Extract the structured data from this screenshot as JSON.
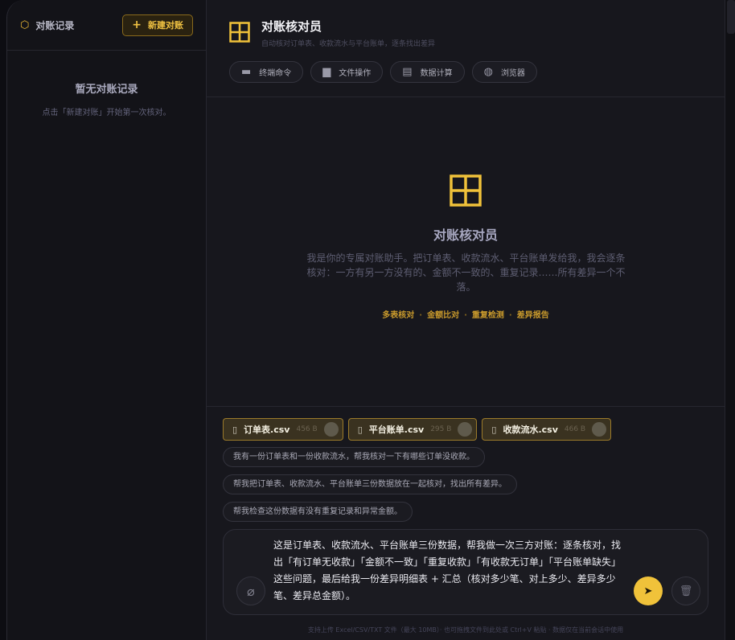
{
  "sidebar": {
    "title": "对账记录",
    "new_button": "新建对账",
    "empty_title": "暂无对账记录",
    "empty_desc": "点击「新建对账」开始第一次核对。"
  },
  "header": {
    "name": "对账核对员",
    "subtitle": "自动核对订单表、收款流水与平台账单，逐条找出差异",
    "tools": [
      {
        "icon": "terminal-icon",
        "label": "终端命令"
      },
      {
        "icon": "folder-icon",
        "label": "文件操作"
      },
      {
        "icon": "spreadsheet-icon",
        "label": "数据计算"
      },
      {
        "icon": "globe-icon",
        "label": "浏览器"
      }
    ]
  },
  "welcome": {
    "title": "对账核对员",
    "desc": "我是你的专属对账助手。把订单表、收款流水、平台账单发给我，我会逐条核对：一方有另一方没有的、金额不一致的、重复记录……所有差异一个不落。",
    "tags": [
      "多表核对",
      "金额比对",
      "重复检测",
      "差异报告"
    ]
  },
  "files": [
    {
      "name": "订单表.csv",
      "size": "456 B"
    },
    {
      "name": "平台账单.csv",
      "size": "295 B"
    },
    {
      "name": "收款流水.csv",
      "size": "466 B"
    }
  ],
  "suggestions": [
    "我有一份订单表和一份收款流水，帮我核对一下有哪些订单没收款。",
    "帮我把订单表、收款流水、平台账单三份数据放在一起核对，找出所有差异。",
    "帮我检查这份数据有没有重复记录和异常金额。"
  ],
  "composer": {
    "text": "这是订单表、收款流水、平台账单三份数据，帮我做一次三方对账：逐条核对，找出「有订单无收款」「金额不一致」「重复收款」「有收款无订单」「平台账单缺失」这些问题，最后给我一份差异明细表 + 汇总（核对多少笔、对上多少、差异多少笔、差异总金额）。"
  },
  "footer": "支持上传 Excel/CSV/TXT 文件（最大 10MB）· 也可拖拽文件到此处或 Ctrl+V 粘贴 · 数据仅在当前会话中使用",
  "colors": {
    "accent": "#f0c23a",
    "background": "#17171d"
  }
}
